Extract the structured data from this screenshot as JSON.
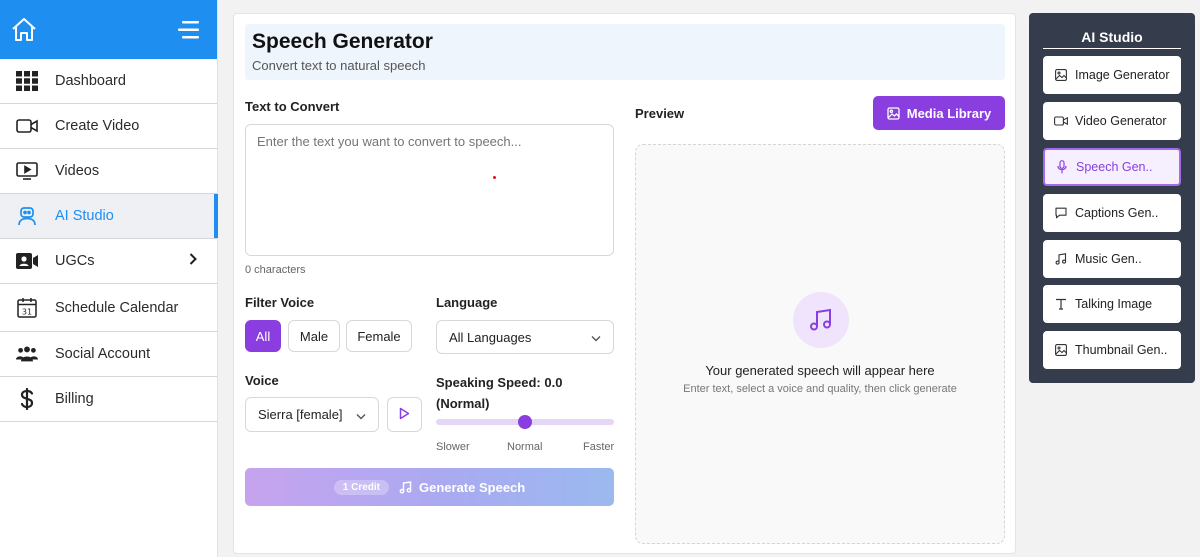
{
  "sidebar": {
    "items": [
      {
        "label": "Dashboard",
        "icon": "grid-icon"
      },
      {
        "label": "Create Video",
        "icon": "video-camera-icon"
      },
      {
        "label": "Videos",
        "icon": "play-screen-icon"
      },
      {
        "label": "AI Studio",
        "icon": "robot-icon",
        "active": true
      },
      {
        "label": "UGCs",
        "icon": "id-card-icon",
        "has_submenu": true
      },
      {
        "label": "Schedule Calendar",
        "icon": "calendar-icon",
        "badge": "31"
      },
      {
        "label": "Social Account",
        "icon": "users-group-icon"
      },
      {
        "label": "Billing",
        "icon": "dollar-icon"
      }
    ]
  },
  "header": {
    "title": "Speech Generator",
    "subtitle": "Convert text to natural speech"
  },
  "form": {
    "text_label": "Text to Convert",
    "text_placeholder": "Enter the text you want to convert to speech...",
    "char_count": "0 characters",
    "filter_label": "Filter Voice",
    "filters": [
      "All",
      "Male",
      "Female"
    ],
    "filter_selected": "All",
    "language_label": "Language",
    "language_value": "All Languages",
    "voice_label": "Voice",
    "voice_value": "Sierra [female]",
    "speed_label": "Speaking Speed: 0.0 (Normal)",
    "speed_value": 0.0,
    "speed_marks": [
      "Slower",
      "Normal",
      "Faster"
    ],
    "credit_badge": "1 Credit",
    "generate_label": "Generate Speech"
  },
  "preview": {
    "label": "Preview",
    "media_library_label": "Media Library",
    "empty_title": "Your generated speech will appear here",
    "empty_subtitle": "Enter text, select a voice and quality, then click generate"
  },
  "ai_studio": {
    "title": "AI Studio",
    "items": [
      {
        "label": "Image Generator",
        "icon": "image-icon"
      },
      {
        "label": "Video Generator",
        "icon": "video-icon"
      },
      {
        "label": "Speech Gen..",
        "icon": "microphone-icon",
        "active": true
      },
      {
        "label": "Captions Gen..",
        "icon": "speech-bubble-icon"
      },
      {
        "label": "Music Gen..",
        "icon": "music-note-icon"
      },
      {
        "label": "Talking Image",
        "icon": "text-t-icon"
      },
      {
        "label": "Thumbnail Gen..",
        "icon": "image-icon"
      }
    ]
  },
  "colors": {
    "brand_blue": "#1f8ef1",
    "accent_purple": "#8a3ee0",
    "panel_dark": "#353c4b"
  }
}
